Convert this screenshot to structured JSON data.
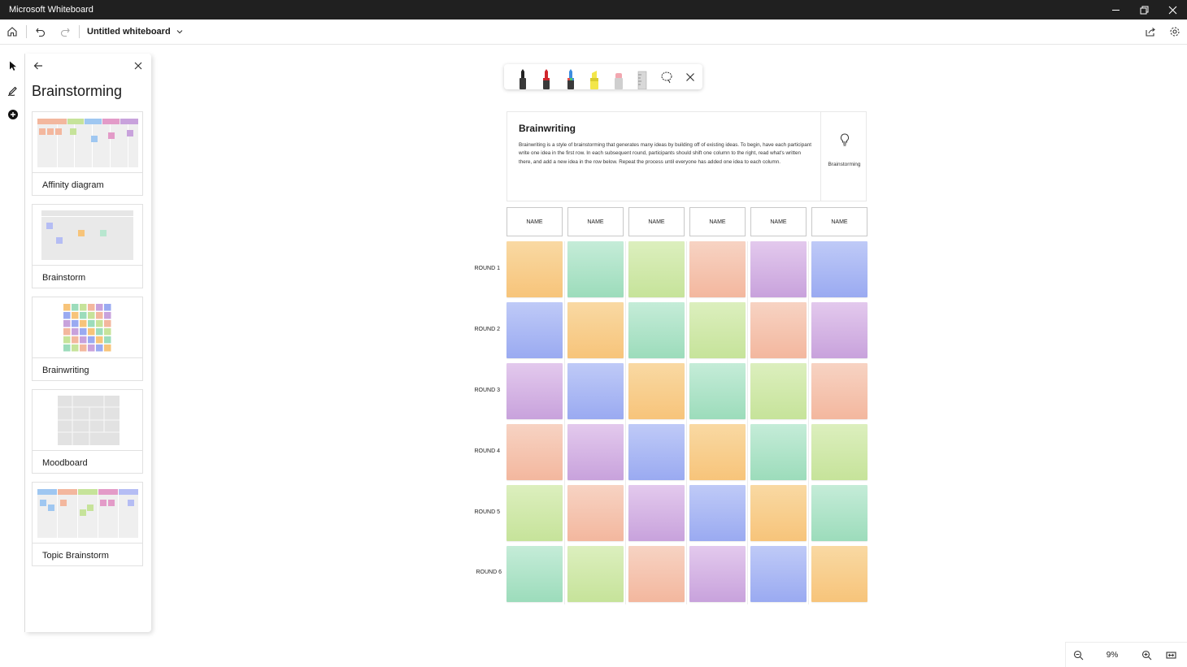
{
  "window": {
    "title": "Microsoft Whiteboard"
  },
  "commandbar": {
    "board_title": "Untitled whiteboard"
  },
  "panel": {
    "title": "Brainstorming",
    "templates": [
      {
        "label": "Affinity diagram"
      },
      {
        "label": "Brainstorm"
      },
      {
        "label": "Brainwriting"
      },
      {
        "label": "Moodboard"
      },
      {
        "label": "Topic Brainstorm"
      }
    ]
  },
  "card": {
    "title": "Brainwriting",
    "description": "Brainwriting is a style of brainstorming that generates many ideas by building off of existing ideas. To begin, have each participant write one idea in the first row. In each subsequent round, participants should shift one column to the right, read what's written there, and add a new idea in the row below. Repeat the process until everyone has added one idea to each column.",
    "category": "Brainstorming"
  },
  "grid": {
    "headers": [
      "NAME",
      "NAME",
      "NAME",
      "NAME",
      "NAME",
      "NAME"
    ],
    "rounds": [
      "ROUND 1",
      "ROUND 2",
      "ROUND 3",
      "ROUND 4",
      "ROUND 5",
      "ROUND 6"
    ],
    "colors": [
      [
        "orange",
        "green",
        "lime",
        "peach",
        "purple",
        "blue"
      ],
      [
        "blue",
        "orange",
        "green",
        "lime",
        "peach",
        "purple"
      ],
      [
        "purple",
        "blue",
        "orange",
        "green",
        "lime",
        "peach"
      ],
      [
        "peach",
        "purple",
        "blue",
        "orange",
        "green",
        "lime"
      ],
      [
        "lime",
        "peach",
        "purple",
        "blue",
        "orange",
        "green"
      ],
      [
        "green",
        "lime",
        "peach",
        "purple",
        "blue",
        "orange"
      ]
    ]
  },
  "palette": {
    "orange": "#f7c47a",
    "green": "#9cdcbb",
    "lime": "#c6e39a",
    "peach": "#f3b79e",
    "purple": "#c8a2dc",
    "blue": "#9aaaf1"
  },
  "zoom": {
    "value": "9%"
  },
  "icons": [
    "home-icon",
    "undo-icon",
    "redo-icon",
    "chevron-down-icon",
    "share-icon",
    "settings-icon",
    "select-icon",
    "inking-icon",
    "add-icon",
    "back-arrow-icon",
    "close-icon",
    "pen-icon",
    "lasso-icon",
    "ruler-icon",
    "eraser-icon",
    "highlighter-icon",
    "lightbulb-icon",
    "zoom-out-icon",
    "zoom-in-icon",
    "fit-screen-icon"
  ]
}
